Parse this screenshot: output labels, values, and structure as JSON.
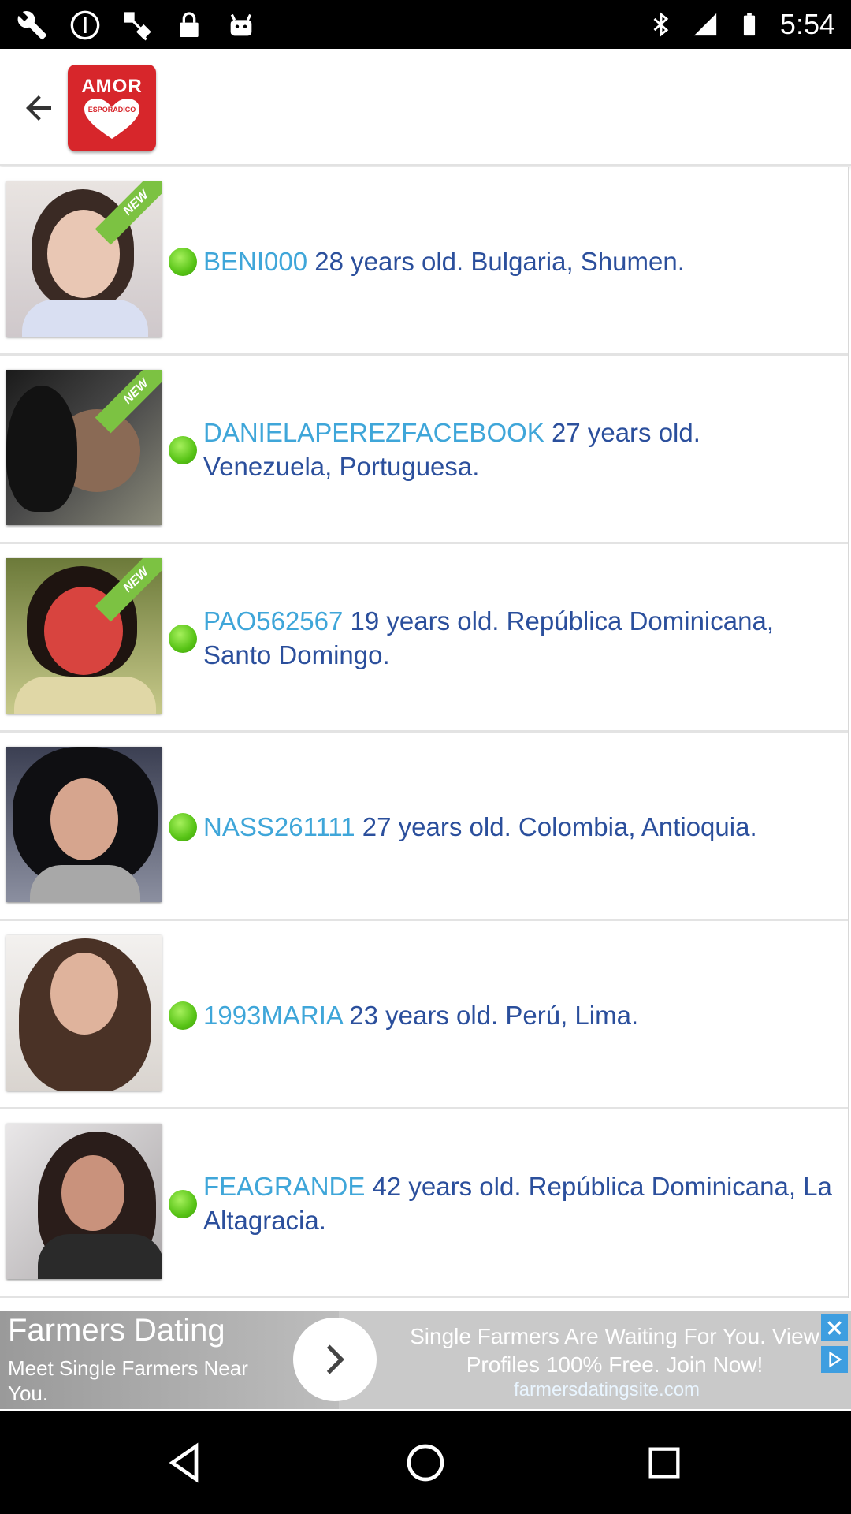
{
  "status_bar": {
    "time": "5:54",
    "left_icons": [
      "wrench-icon",
      "no-disturb-icon",
      "fake-gps-icon",
      "lock-icon",
      "android-icon"
    ],
    "right_icons": [
      "bluetooth-icon",
      "cellular-signal-icon",
      "battery-icon"
    ]
  },
  "header": {
    "back_icon": "arrow-back-icon",
    "logo_title": "AMOR",
    "logo_subtitle": "ESPORADICO"
  },
  "profiles": [
    {
      "username": "BENI000",
      "details": " 28 years old. Bulgaria, Shumen.",
      "is_new": true,
      "online": true
    },
    {
      "username": "DANIELAPEREZFACEBOOK",
      "details": " 27 years old. Venezuela, Portuguesa.",
      "is_new": true,
      "online": true
    },
    {
      "username": "PAO562567",
      "details": " 19 years old. República Dominicana, Santo Domingo.",
      "is_new": true,
      "online": true
    },
    {
      "username": "NASS261111",
      "details": " 27 years old. Colombia, Antioquia.",
      "is_new": false,
      "online": true
    },
    {
      "username": "1993MARIA",
      "details": " 23 years old. Perú, Lima.",
      "is_new": false,
      "online": true
    },
    {
      "username": "FEAGRANDE",
      "details": " 42 years old. República Dominicana, La Altagracia.",
      "is_new": false,
      "online": true
    }
  ],
  "new_badge": "NEW",
  "ad": {
    "title": "Farmers Dating",
    "description": "Meet Single Farmers Near You.",
    "headline": "Single Farmers Are Waiting For You. View Profiles 100% Free. Join Now!",
    "url": "farmersdatingsite.com"
  },
  "nav_bar": {
    "icons": [
      "back-triangle-icon",
      "home-circle-icon",
      "recents-square-icon"
    ]
  },
  "colors": {
    "username": "#3fa6d9",
    "details": "#2b4f9c",
    "online_dot": "#57c316",
    "new_ribbon": "#7cc242",
    "logo_bg": "#d7262b"
  }
}
